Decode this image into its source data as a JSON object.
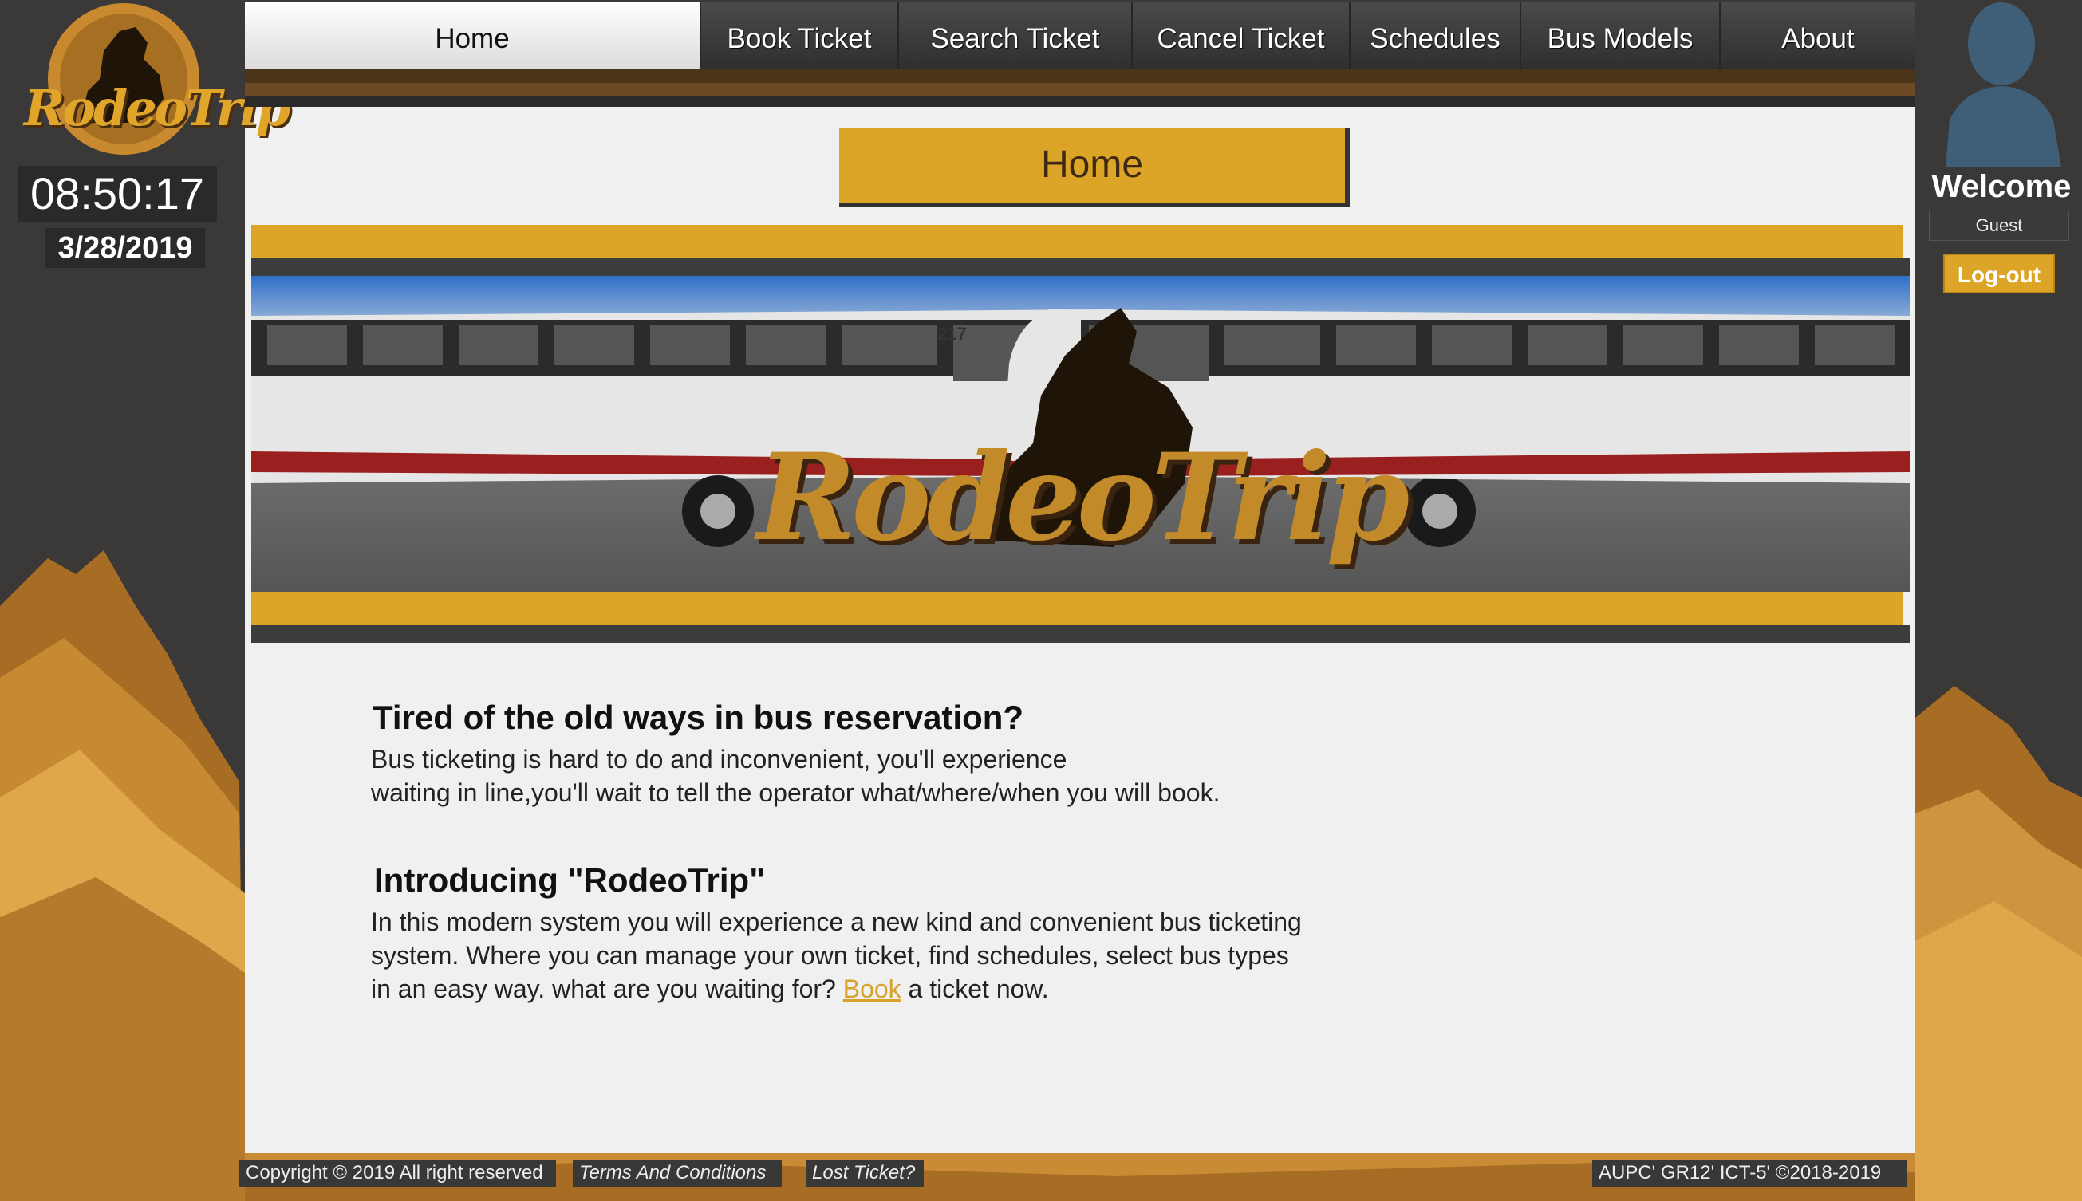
{
  "app": {
    "name": "RodeoTrip"
  },
  "colors": {
    "accent": "#dca527",
    "dark": "#3b3937",
    "panel": "#f0f0f0"
  },
  "clock": {
    "time": "08:50:17",
    "date": "3/28/2019"
  },
  "nav": {
    "items": [
      {
        "label": "Home",
        "active": true
      },
      {
        "label": "Book Ticket",
        "active": false
      },
      {
        "label": "Search Ticket",
        "active": false
      },
      {
        "label": "Cancel Ticket",
        "active": false
      },
      {
        "label": "Schedules",
        "active": false
      },
      {
        "label": "Bus Models",
        "active": false
      },
      {
        "label": "About",
        "active": false
      }
    ]
  },
  "page": {
    "title": "Home"
  },
  "banner": {
    "logo_text": "RodeoTrip",
    "bus_number": "217"
  },
  "sections": [
    {
      "heading": "Tired of the old ways in bus reservation?",
      "line1": "Bus ticketing is hard to do and inconvenient, you'll experience",
      "line2": "waiting in line,you'll wait to tell the operator what/where/when you will book."
    },
    {
      "heading": "Introducing \"RodeoTrip\"",
      "line1": "In this modern system you will experience a new kind and convenient bus ticketing",
      "line2": "system. Where you can manage your own ticket, find schedules, select bus types",
      "line3_before": "in an easy way. what are you waiting for? ",
      "link": "Book",
      "line3_after": " a ticket now."
    }
  ],
  "user": {
    "welcome": "Welcome",
    "name": "Guest",
    "logout": "Log-out"
  },
  "footer": {
    "copyright": "Copyright © 2019 All right reserved",
    "terms": "Terms And Conditions",
    "lost": "Lost Ticket?",
    "credit": "AUPC' GR12' ICT-5' ©2018-2019"
  }
}
